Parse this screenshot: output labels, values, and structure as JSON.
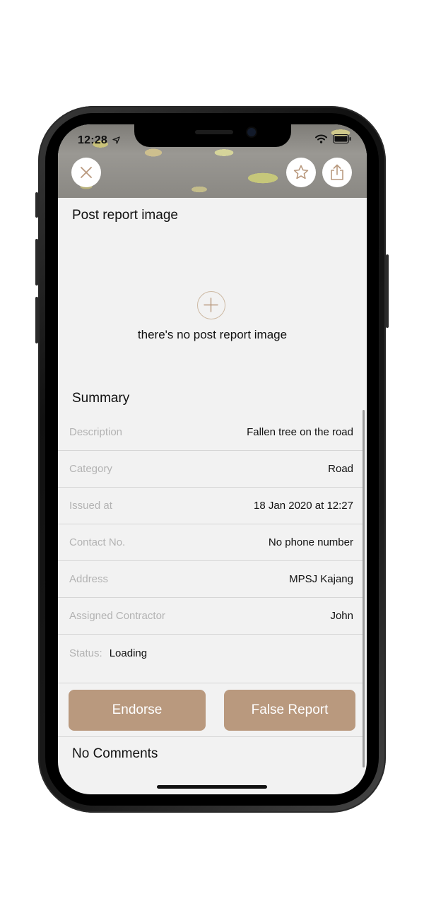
{
  "status_bar": {
    "time": "12:28"
  },
  "toolbar": {
    "close_icon": "close-icon",
    "favorite_icon": "star-icon",
    "share_icon": "share-icon"
  },
  "post_report": {
    "title": "Post report image",
    "empty_icon": "plus-icon",
    "empty_text": "there's no post report image"
  },
  "summary": {
    "title": "Summary",
    "rows": [
      {
        "label": "Description",
        "value": "Fallen tree on the road"
      },
      {
        "label": "Category",
        "value": "Road"
      },
      {
        "label": "Issued at",
        "value": "18 Jan 2020 at 12:27"
      },
      {
        "label": "Contact No.",
        "value": "No phone number"
      },
      {
        "label": "Address",
        "value": "MPSJ Kajang"
      },
      {
        "label": "Assigned Contractor",
        "value": "John"
      }
    ],
    "status": {
      "label": "Status:",
      "value": "Loading"
    }
  },
  "actions": {
    "endorse_label": "Endorse",
    "false_report_label": "False Report",
    "button_color": "#b9997e"
  },
  "comments": {
    "title": "No Comments"
  }
}
